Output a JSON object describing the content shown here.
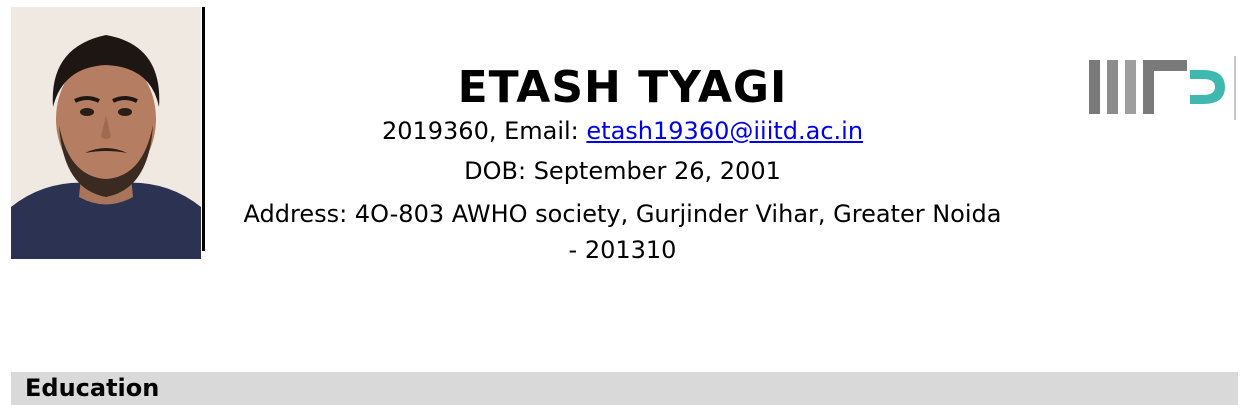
{
  "header": {
    "name": "ETASH TYAGI",
    "roll_prefix": "2019360, Email: ",
    "email": "etash19360@iiitd.ac.in",
    "dob": "DOB: September 26, 2001",
    "address_line1": "Address: 4O-803 AWHO society, Gurjinder Vihar, Greater Noida",
    "address_line2": "- 201310"
  },
  "photo": {
    "icon": "profile-photo"
  },
  "logo": {
    "icon": "iiitd-logo",
    "colors": {
      "gray_dark": "#7a7a7a",
      "gray_light": "#b0b0b0",
      "teal": "#3fb8af"
    }
  },
  "sections": [
    {
      "title": "Education"
    }
  ],
  "colors": {
    "section_bar": "#d9d9d9",
    "link": "#0000ee"
  }
}
